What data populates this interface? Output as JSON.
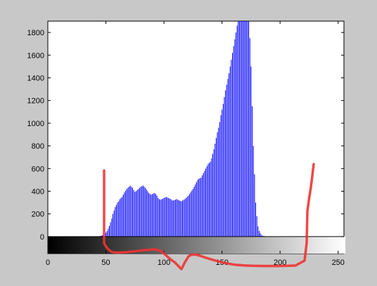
{
  "chart_data": {
    "type": "bar",
    "title": "",
    "xlabel": "",
    "ylabel": "",
    "xlim": [
      0,
      255
    ],
    "ylim": [
      -150,
      1900
    ],
    "x_ticks": [
      0,
      50,
      100,
      150,
      200,
      250
    ],
    "y_ticks": [
      0,
      200,
      400,
      600,
      800,
      1000,
      1200,
      1400,
      1600,
      1800
    ],
    "grid": false,
    "legend": "none",
    "colorbar": "grayscale gradient 0-255 below the x-axis",
    "colors": {
      "bars": "#0000ff",
      "annotation": "#ee3333",
      "figure_bg": "#c8c8c8",
      "plot_bg": "#ffffff"
    },
    "series": [
      {
        "x": [
          45,
          46,
          47,
          48,
          49,
          50,
          51,
          52,
          53,
          54,
          55,
          56,
          57,
          58,
          59,
          60,
          61,
          62,
          63,
          64,
          65,
          66,
          67,
          68,
          69,
          70,
          71,
          72,
          73,
          74,
          75,
          76,
          77,
          78,
          79,
          80,
          81,
          82,
          83,
          84,
          85,
          86,
          87,
          88,
          89,
          90,
          91,
          92,
          93,
          94,
          95,
          96,
          97,
          98,
          99,
          100,
          101,
          102,
          103,
          104,
          105,
          106,
          107,
          108,
          109,
          110,
          111,
          112,
          113,
          114,
          115,
          116,
          117,
          118,
          119,
          120,
          121,
          122,
          123,
          124,
          125,
          126,
          127,
          128,
          129,
          130,
          131,
          132,
          133,
          134,
          135,
          136,
          137,
          138,
          139,
          140,
          141,
          142,
          143,
          144,
          145,
          146,
          147,
          148,
          149,
          150,
          151,
          152,
          153,
          154,
          155,
          156,
          157,
          158,
          159,
          160,
          161,
          162,
          163,
          164,
          165,
          166,
          167,
          168,
          169,
          170,
          171,
          172,
          173,
          174,
          175,
          176,
          177,
          178,
          179,
          180,
          181,
          182,
          183,
          184,
          185,
          186,
          187,
          188,
          189,
          190,
          191,
          192,
          193,
          194,
          195,
          196,
          197,
          198,
          199,
          200,
          201,
          202,
          203,
          204,
          205,
          206,
          207,
          208,
          209,
          210,
          211,
          212,
          213,
          214,
          215,
          216,
          217,
          218,
          219,
          220,
          221,
          222,
          223,
          224,
          225,
          226,
          227,
          228,
          229,
          230,
          231
        ],
        "values": [
          5,
          8,
          12,
          18,
          25,
          35,
          50,
          70,
          95,
          125,
          160,
          200,
          230,
          260,
          280,
          300,
          310,
          330,
          340,
          350,
          370,
          390,
          405,
          420,
          430,
          440,
          450,
          440,
          430,
          410,
          395,
          400,
          410,
          420,
          430,
          440,
          445,
          450,
          440,
          430,
          415,
          400,
          385,
          375,
          370,
          375,
          380,
          385,
          375,
          360,
          340,
          330,
          325,
          330,
          335,
          340,
          345,
          350,
          345,
          340,
          335,
          330,
          320,
          318,
          322,
          326,
          330,
          325,
          320,
          315,
          312,
          318,
          325,
          330,
          340,
          350,
          360,
          375,
          390,
          405,
          420,
          440,
          460,
          480,
          500,
          510,
          515,
          520,
          540,
          560,
          580,
          600,
          620,
          640,
          650,
          660,
          690,
          730,
          770,
          820,
          870,
          920,
          960,
          1010,
          1070,
          1120,
          1170,
          1230,
          1290,
          1340,
          1390,
          1440,
          1500,
          1560,
          1620,
          1680,
          1740,
          1800,
          1860,
          1920,
          1950,
          1960,
          1970,
          1960,
          1950,
          1940,
          1930,
          1920,
          1900,
          1750,
          1500,
          1150,
          800,
          550,
          300,
          180,
          90,
          50,
          30,
          15,
          8,
          5,
          3,
          2,
          1,
          1,
          1,
          1,
          1,
          1,
          1,
          1,
          1,
          1,
          1,
          1,
          1,
          1,
          1,
          1,
          1,
          1,
          1,
          1,
          1,
          1,
          1,
          1,
          1,
          1,
          1,
          1,
          1,
          1,
          1,
          1,
          1,
          1,
          1,
          1,
          1,
          1,
          1,
          1,
          1,
          1,
          1
        ]
      }
    ]
  }
}
